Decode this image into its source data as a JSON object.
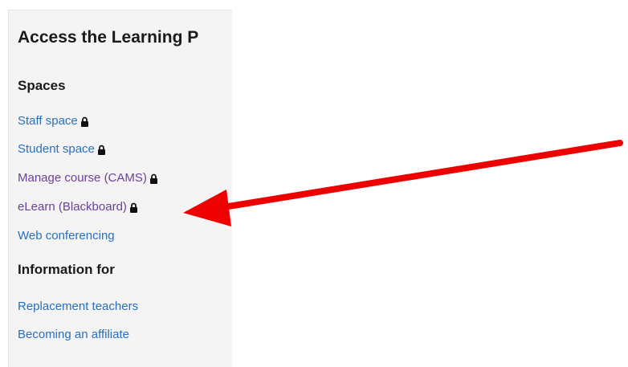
{
  "panel": {
    "title": "Access the Learning P",
    "sections": [
      {
        "heading": "Spaces",
        "links": [
          {
            "label": "Staff space",
            "locked": true
          },
          {
            "label": "Student space",
            "locked": true
          },
          {
            "label": "Manage course (CAMS)",
            "locked": true
          },
          {
            "label": "eLearn (Blackboard)",
            "locked": true
          },
          {
            "label": "Web conferencing",
            "locked": false
          }
        ]
      },
      {
        "heading": "Information for",
        "links": [
          {
            "label": "Replacement teachers",
            "locked": false
          },
          {
            "label": "Becoming an affiliate",
            "locked": false
          }
        ]
      }
    ]
  },
  "colors": {
    "link": "#2a6fbf",
    "visited_link": "#6b3f9a",
    "panel_bg": "#f4f4f4",
    "annotation_arrow": "#ee0000"
  },
  "icons": {
    "lock": "lock-icon",
    "annotation": "red-arrow-icon"
  }
}
